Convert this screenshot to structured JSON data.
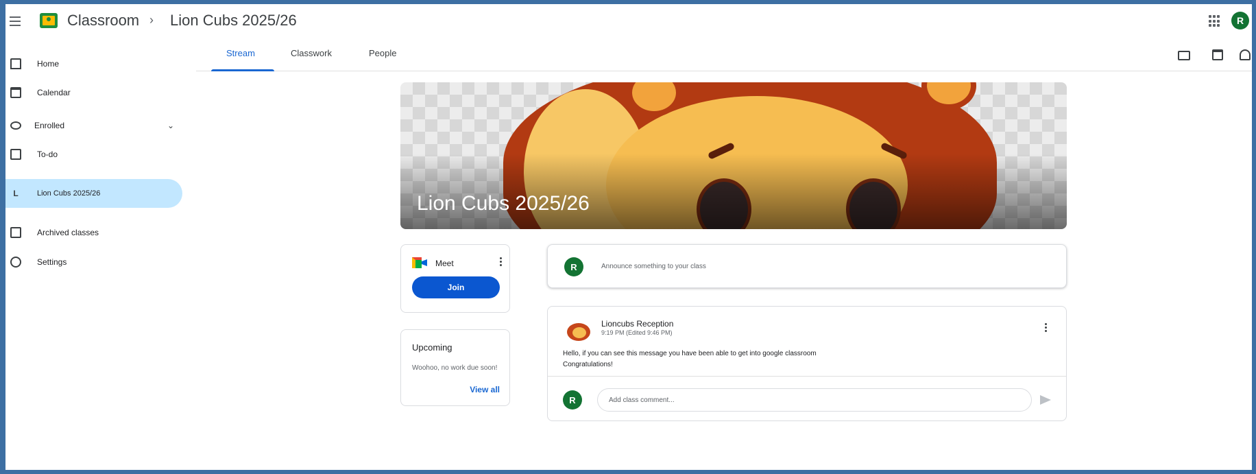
{
  "header": {
    "app_name": "Classroom",
    "breadcrumb_separator": "›",
    "class_name": "Lion Cubs 2025/26",
    "avatar_initial": "R"
  },
  "tabs": [
    {
      "label": "Stream",
      "active": true
    },
    {
      "label": "Classwork",
      "active": false
    },
    {
      "label": "People",
      "active": false
    }
  ],
  "sidebar": {
    "items": [
      {
        "label": "Home",
        "icon": "home-icon"
      },
      {
        "label": "Calendar",
        "icon": "calendar-icon"
      },
      {
        "label": "Enrolled",
        "icon": "enrolled-icon"
      },
      {
        "label": "To-do",
        "icon": "todo-icon"
      },
      {
        "label": "Lion Cubs 2025/26",
        "icon": "class-letter-icon",
        "letter": "L",
        "active": true
      },
      {
        "label": "Archived classes",
        "icon": "archive-icon"
      },
      {
        "label": "Settings",
        "icon": "settings-icon"
      }
    ]
  },
  "banner": {
    "title": "Lion Cubs 2025/26"
  },
  "meet": {
    "label": "Meet",
    "join_label": "Join"
  },
  "upcoming": {
    "title": "Upcoming",
    "empty_text": "Woohoo, no work due soon!",
    "view_all": "View all"
  },
  "announce": {
    "avatar_initial": "R",
    "placeholder": "Announce something to your class"
  },
  "post": {
    "author": "Lioncubs Reception",
    "time": "9:19 PM (Edited 9:46 PM)",
    "body_line1": "Hello, if you can see this message you have been able to get into google classroom",
    "body_line2": "Congratulations!",
    "comment_avatar_initial": "R",
    "comment_placeholder": "Add class comment..."
  },
  "colors": {
    "accent_blue": "#1967d2",
    "join_button": "#0b57d0",
    "avatar_green": "#137333",
    "active_nav": "#c2e7ff"
  }
}
